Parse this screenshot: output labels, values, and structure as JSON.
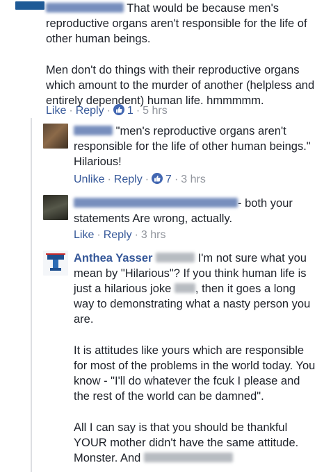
{
  "comments": [
    {
      "author_blurred": true,
      "paragraphs": [
        "That would be because men's reproductive organs aren't responsible for the life of other human beings.",
        "Men don't do things with their reproductive organs which amount to the murder of another (helpless and entirely dependent) human life. hmmmmm."
      ],
      "actions": {
        "like": "Like",
        "reply": "Reply",
        "reactions": "1",
        "time": "5 hrs"
      }
    },
    {
      "author_blurred": true,
      "text": "\"men's reproductive organs aren't responsible for the life of other human beings.\" Hilarious!",
      "actions": {
        "like": "Unlike",
        "reply": "Reply",
        "reactions": "7",
        "time": "3 hrs"
      }
    },
    {
      "author_blurred": true,
      "text": "- both your statements Are wrong, actually.",
      "actions": {
        "like": "Like",
        "reply": "Reply",
        "time": "3 hrs"
      }
    },
    {
      "author": "Anthea Yasser",
      "p1_a": "I'm not sure what you mean by \"Hilarious\"? If you think human life is just a hilarious joke",
      "p1_b": ", then it goes a long way to demonstrating what a nasty person you are.",
      "p2": "It is attitudes like yours which are responsible for most of the problems in the world today. You know - \"I'll do whatever the fcuk I please and the rest of the world can be damned\".",
      "p3": "All I can say is that you should be thankful YOUR mother didn't have the same attitude. Monster. And"
    }
  ],
  "colors": {
    "link": "#365899",
    "meta": "#90949c",
    "like_badge": "#4267b2"
  }
}
